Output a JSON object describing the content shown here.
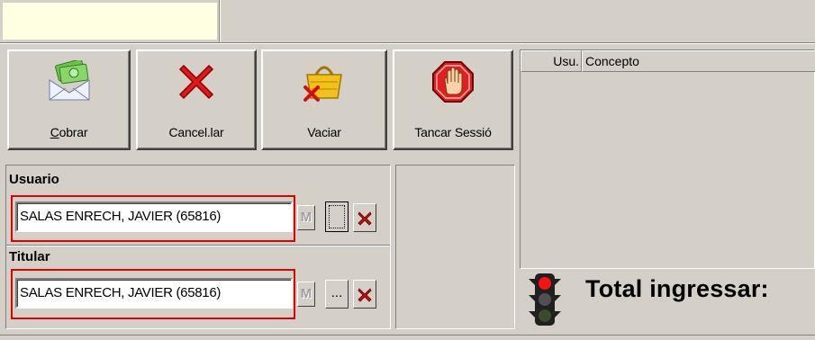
{
  "toolbar": {
    "cobrar": {
      "label_u": "C",
      "label_rest": "obrar",
      "icon": "envelope-money-icon"
    },
    "cancelar": {
      "label": "Cancel.lar",
      "icon": "red-x-icon"
    },
    "vaciar": {
      "label": "Vaciar",
      "icon": "empty-basket-icon"
    },
    "tancar": {
      "label": "Tancar Sessió",
      "icon": "stop-hand-icon"
    }
  },
  "usuario": {
    "label": "Usuario",
    "value": "SALAS ENRECH, JAVIER (65816)",
    "m_button": "M",
    "search_button": "",
    "clear_icon": "red-x-icon"
  },
  "titular": {
    "label": "Titular",
    "value": "SALAS ENRECH, JAVIER (65816)",
    "m_button": "M",
    "search_button": "...",
    "clear_icon": "red-x-icon"
  },
  "grid": {
    "columns": [
      "Usu.",
      "Concepto"
    ]
  },
  "total": {
    "label": "Total ingressar:",
    "icon": "traffic-light-icon"
  },
  "colors": {
    "highlight": "#e30000",
    "background": "#d4d0c8",
    "yellow_field": "#ffffe1"
  }
}
